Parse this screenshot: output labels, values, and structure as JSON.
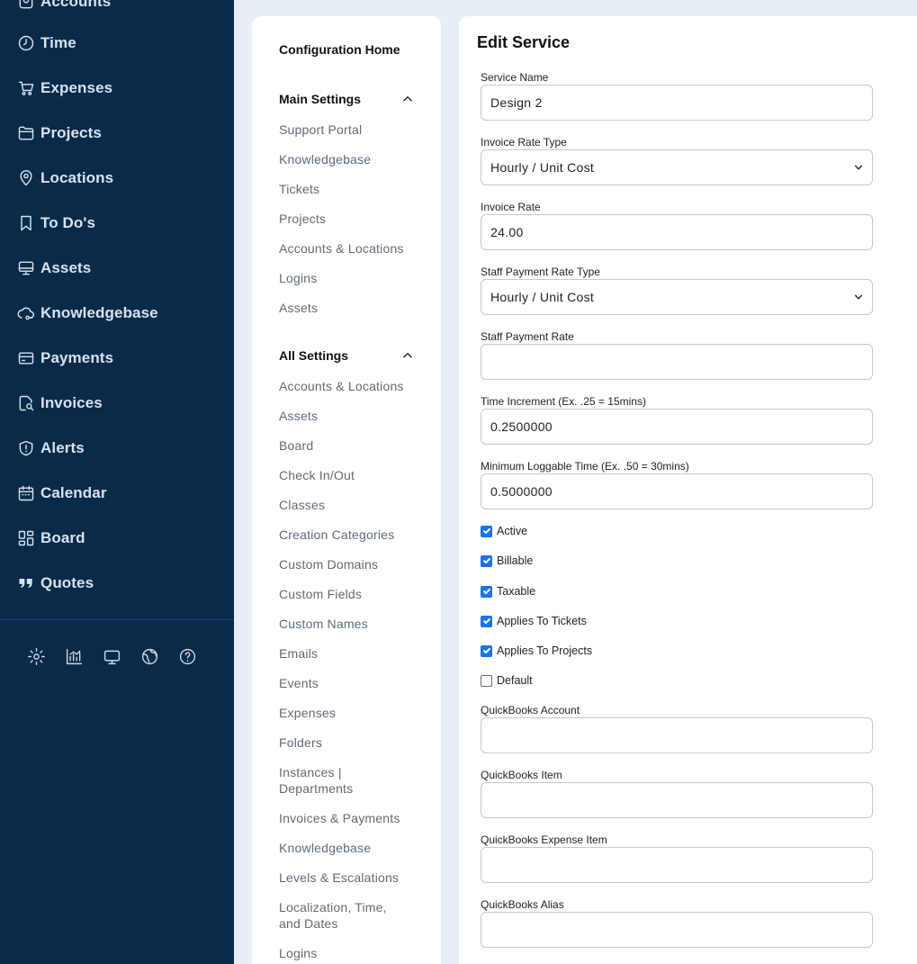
{
  "nav": {
    "top_partial_label": "Accounts",
    "items": [
      {
        "label": "Time",
        "icon": "clock-icon"
      },
      {
        "label": "Expenses",
        "icon": "cart-icon"
      },
      {
        "label": "Projects",
        "icon": "folder-icon"
      },
      {
        "label": "Locations",
        "icon": "map-pin-icon"
      },
      {
        "label": "To Do's",
        "icon": "bookmark-icon"
      },
      {
        "label": "Assets",
        "icon": "monitor-icon"
      },
      {
        "label": "Knowledgebase",
        "icon": "knowledge-icon"
      },
      {
        "label": "Payments",
        "icon": "credit-card-icon"
      },
      {
        "label": "Invoices",
        "icon": "invoice-search-icon"
      },
      {
        "label": "Alerts",
        "icon": "shield-alert-icon"
      },
      {
        "label": "Calendar",
        "icon": "calendar-icon"
      },
      {
        "label": "Board",
        "icon": "board-icon"
      },
      {
        "label": "Quotes",
        "icon": "quote-icon"
      }
    ],
    "utility_icons": [
      "gear-icon",
      "chart-icon",
      "desktop-icon",
      "globe-icon",
      "help-icon"
    ]
  },
  "menu": {
    "home": "Configuration Home",
    "main_settings": {
      "title": "Main Settings",
      "items": [
        "Support Portal",
        "Knowledgebase",
        "Tickets",
        "Projects",
        "Accounts & Locations",
        "Logins",
        "Assets"
      ]
    },
    "all_settings": {
      "title": "All Settings",
      "items": [
        "Accounts & Locations",
        "Assets",
        "Board",
        "Check In/Out",
        "Classes",
        "Creation Categories",
        "Custom Domains",
        "Custom Fields",
        "Custom Names",
        "Emails",
        "Events",
        "Expenses",
        "Folders",
        "Instances | Departments",
        "Invoices & Payments",
        "Knowledgebase",
        "Levels & Escalations",
        "Localization, Time, and Dates",
        "Logins"
      ]
    }
  },
  "form": {
    "title": "Edit Service",
    "service_name": {
      "label": "Service Name",
      "value": "Design 2"
    },
    "invoice_rate_type": {
      "label": "Invoice Rate Type",
      "value": "Hourly / Unit Cost"
    },
    "invoice_rate": {
      "label": "Invoice Rate",
      "value": "24.00"
    },
    "staff_payment_rate_type": {
      "label": "Staff Payment Rate Type",
      "value": "Hourly / Unit Cost"
    },
    "staff_payment_rate": {
      "label": "Staff Payment Rate",
      "value": ""
    },
    "time_increment": {
      "label": "Time Increment (Ex. .25 = 15mins)",
      "value": "0.2500000"
    },
    "minimum_loggable_time": {
      "label": "Minimum Loggable Time (Ex. .50 = 30mins)",
      "value": "0.5000000"
    },
    "checkboxes": [
      {
        "label": "Active",
        "checked": true
      },
      {
        "label": "Billable",
        "checked": true
      },
      {
        "label": "Taxable",
        "checked": true
      },
      {
        "label": "Applies To Tickets",
        "checked": true
      },
      {
        "label": "Applies To Projects",
        "checked": true
      },
      {
        "label": "Default",
        "checked": false
      }
    ],
    "quickbooks_account": {
      "label": "QuickBooks Account",
      "value": ""
    },
    "quickbooks_item": {
      "label": "QuickBooks Item",
      "value": ""
    },
    "quickbooks_expense_item": {
      "label": "QuickBooks Expense Item",
      "value": ""
    },
    "quickbooks_alias": {
      "label": "QuickBooks Alias",
      "value": ""
    }
  },
  "colors": {
    "nav_bg": "#0a2a4a",
    "page_bg": "#e8eef6",
    "checkbox_accent": "#1a73e8"
  }
}
